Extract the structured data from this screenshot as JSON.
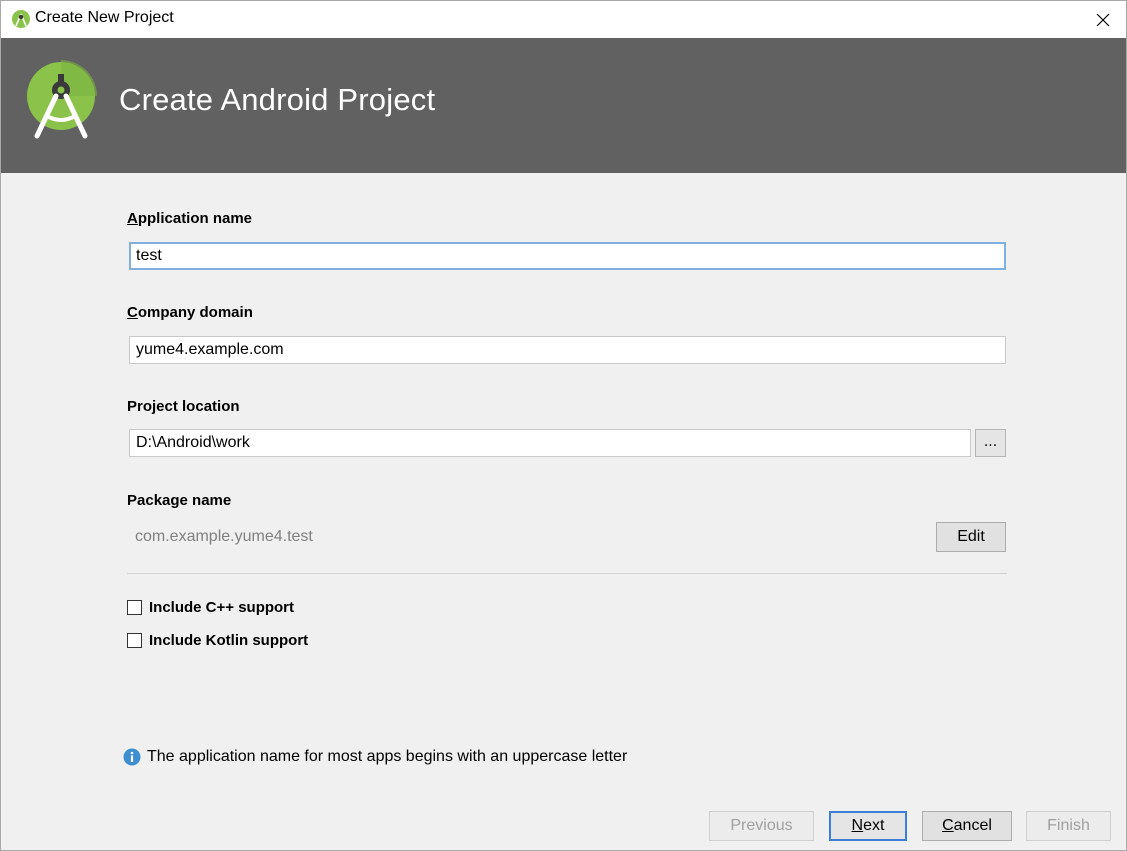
{
  "window": {
    "title": "Create New Project",
    "close_glyph": "✕"
  },
  "banner": {
    "title": "Create Android Project",
    "logo_icon": "android-studio-icon"
  },
  "form": {
    "app_name": {
      "label_accel": "A",
      "label_rest": "pplication name",
      "value": "test"
    },
    "company_domain": {
      "label_accel": "C",
      "label_rest": "ompany domain",
      "value": "yume4.example.com"
    },
    "project_location": {
      "label": "Project location",
      "value": "D:\\Android\\work",
      "browse_label": "..."
    },
    "package_name": {
      "label": "Package name",
      "value": "com.example.yume4.test",
      "edit_label": "Edit"
    },
    "include_cpp": {
      "label": "Include C++ support",
      "checked": false
    },
    "include_kotlin": {
      "label": "Include Kotlin support",
      "checked": false
    }
  },
  "info": {
    "icon": "info-icon",
    "text": "The application name for most apps begins with an uppercase letter"
  },
  "buttons": {
    "previous": "Previous",
    "next_accel": "N",
    "next_rest": "ext",
    "cancel_accel": "C",
    "cancel_rest": "ancel",
    "finish": "Finish"
  },
  "colors": {
    "banner_bg": "#616161",
    "dialog_bg": "#f0f0f0",
    "focus_border": "#80b0e0",
    "default_button_border": "#3c7fd8",
    "info_blue": "#3d8fd1",
    "logo_green": "#8bc34a"
  }
}
